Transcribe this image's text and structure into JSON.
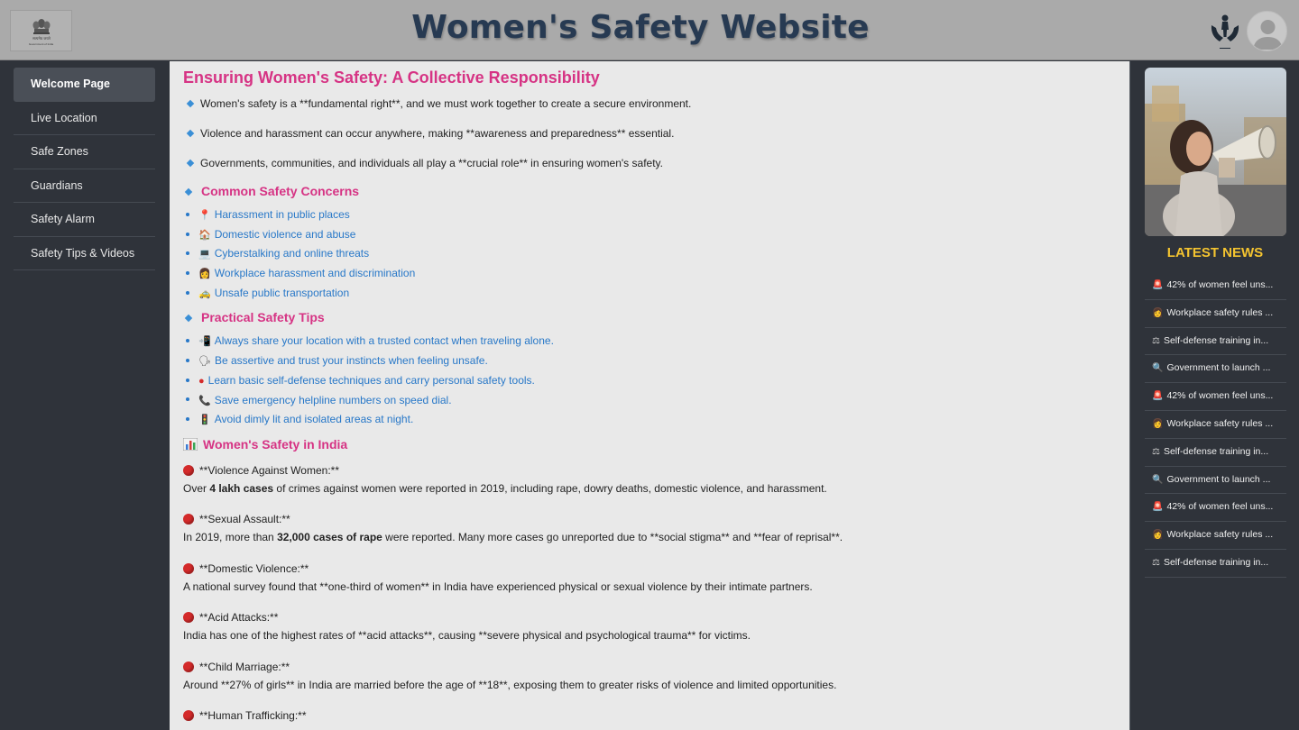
{
  "header": {
    "title": "Women's Safety Website",
    "emblem_caption": "Government of India",
    "emblem_label": "सत्यमेव जयते",
    "logo_icon": "hands-woman-icon",
    "avatar_icon": "user-avatar-icon"
  },
  "sidebar": {
    "items": [
      {
        "label": "Welcome Page",
        "active": true
      },
      {
        "label": "Live Location"
      },
      {
        "label": "Safe Zones"
      },
      {
        "label": "Guardians"
      },
      {
        "label": "Safety Alarm"
      },
      {
        "label": "Safety Tips & Videos"
      }
    ]
  },
  "main": {
    "title": "Ensuring Women's Safety: A Collective Responsibility",
    "intro": [
      "Women's safety is a **fundamental right**, and we must work together to create a secure environment.",
      "Violence and harassment can occur anywhere, making **awareness and preparedness** essential.",
      "Governments, communities, and individuals all play a **crucial role** in ensuring women's safety."
    ],
    "concerns_heading": "Common Safety Concerns",
    "concerns": [
      {
        "icon": "📍",
        "text": "Harassment in public places"
      },
      {
        "icon": "🏠",
        "text": "Domestic violence and abuse"
      },
      {
        "icon": "💻",
        "text": "Cyberstalking and online threats"
      },
      {
        "icon": "👩",
        "text": "Workplace harassment and discrimination"
      },
      {
        "icon": "🚕",
        "text": "Unsafe public transportation"
      }
    ],
    "tips_heading": "Practical Safety Tips",
    "tips": [
      {
        "icon": "📲",
        "text": "Always share your location with a trusted contact when traveling alone."
      },
      {
        "icon": "🗣",
        "text": "Be assertive and trust your instincts when feeling unsafe."
      },
      {
        "icon": "●",
        "text": "Learn basic self-defense techniques and carry personal safety tools."
      },
      {
        "icon": "📞",
        "text": "Save emergency helpline numbers on speed dial."
      },
      {
        "icon": "🚦",
        "text": "Avoid dimly lit and isolated areas at night."
      }
    ],
    "india_heading": "Women's Safety in India",
    "stats": [
      {
        "title": "**Violence Against Women:**",
        "pre": "Over ",
        "bold": "4 lakh cases",
        "post": " of crimes against women were reported in 2019, including rape, dowry deaths, domestic violence, and harassment."
      },
      {
        "title": "**Sexual Assault:**",
        "pre": "In 2019, more than ",
        "bold": "32,000 cases of rape",
        "post": " were reported. Many more cases go unreported due to **social stigma** and **fear of reprisal**."
      },
      {
        "title": "**Domestic Violence:**",
        "pre": "A national survey found that **one-third of women** in India have experienced physical or sexual violence by their intimate partners.",
        "bold": "",
        "post": ""
      },
      {
        "title": "**Acid Attacks:**",
        "pre": "India has one of the highest rates of **acid attacks**, causing **severe physical and psychological trauma** for victims.",
        "bold": "",
        "post": ""
      },
      {
        "title": "**Child Marriage:**",
        "pre": "Around **27% of girls** in India are married before the age of **18**, exposing them to greater risks of violence and limited opportunities.",
        "bold": "",
        "post": ""
      },
      {
        "title": "**Human Trafficking:**",
        "pre": "",
        "bold": "",
        "post": ""
      }
    ]
  },
  "news": {
    "title": "LATEST NEWS",
    "items": [
      {
        "icon": "🚨",
        "text": "42% of women feel uns..."
      },
      {
        "icon": "👩",
        "text": "Workplace safety rules ..."
      },
      {
        "icon": "⚖",
        "text": "Self-defense training in..."
      },
      {
        "icon": "🔍",
        "text": "Government to launch ..."
      },
      {
        "icon": "🚨",
        "text": "42% of women feel uns..."
      },
      {
        "icon": "👩",
        "text": "Workplace safety rules ..."
      },
      {
        "icon": "⚖",
        "text": "Self-defense training in..."
      },
      {
        "icon": "🔍",
        "text": "Government to launch ..."
      },
      {
        "icon": "🚨",
        "text": "42% of women feel uns..."
      },
      {
        "icon": "👩",
        "text": "Workplace safety rules ..."
      },
      {
        "icon": "⚖",
        "text": "Self-defense training in..."
      }
    ]
  },
  "colors": {
    "header_bg": "#aaaaaa",
    "title": "#273a52",
    "sidebar_bg": "#2f333a",
    "main_bg": "#e9e9e9",
    "heading_pink": "#d63384",
    "link_blue": "#2878c8",
    "news_title": "#f4c430"
  }
}
